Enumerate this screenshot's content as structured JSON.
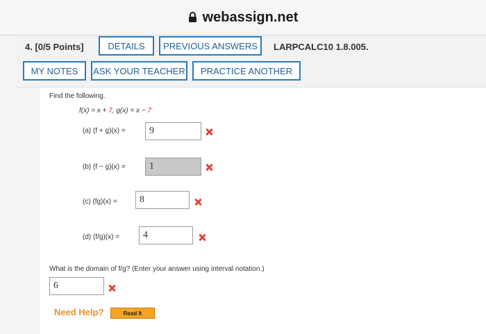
{
  "browser": {
    "url": "webassign.net",
    "lock_icon": "lock-icon"
  },
  "question": {
    "number": "4.  [0/5 Points]",
    "buttons": {
      "details": "DETAILS",
      "previous_answers": "PREVIOUS ANSWERS",
      "my_notes": "MY NOTES",
      "ask_teacher": "ASK YOUR TEACHER",
      "practice_another": "PRACTICE ANOTHER"
    },
    "code": "LARPCALC10 1.8.005."
  },
  "body": {
    "prompt": "Find the following.",
    "def_f": "f(x) = x + ",
    "def_f_num": "7",
    "def_sep": ",  g(x) = x − ",
    "def_g_num": "7",
    "parts": [
      {
        "label": "(a)   (f + g)(x)  =",
        "answer": "9",
        "correct": false
      },
      {
        "label": "(b)   (f − g)(x)  =",
        "answer": "1",
        "correct": false
      },
      {
        "label": "(c)   (fg)(x)  =",
        "answer": "8",
        "correct": false
      },
      {
        "label": "(d)   (f/g)(x)  =",
        "answer": "4",
        "correct": false
      }
    ],
    "domain_prompt": "What is the domain of f/g? (Enter your answer using interval notation.)",
    "domain_answer": "6",
    "need_help": "Need Help?",
    "read_it": "Read It"
  },
  "colors": {
    "button_border": "#2b7bb9",
    "button_text": "#1f5f99",
    "incorrect": "#e0443c",
    "help": "#e8922a",
    "readit_bg": "#f5a623"
  }
}
